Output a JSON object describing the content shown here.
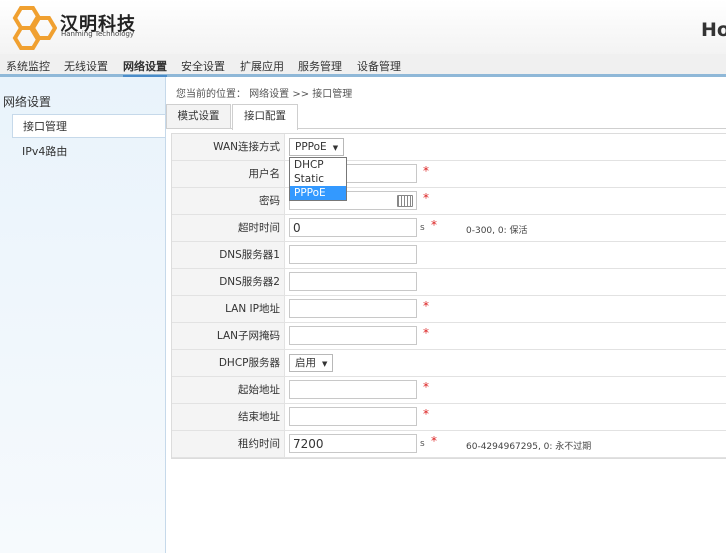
{
  "header": {
    "brand_cn": "汉明科技",
    "brand_en": "Hanming Technology",
    "right_title": "Ho",
    "logo_icon": "hexagon-logo-icon",
    "logo_color": "#f0a030"
  },
  "topnav": {
    "items": [
      "系统监控",
      "无线设置",
      "网络设置",
      "安全设置",
      "扩展应用",
      "服务管理",
      "设备管理"
    ],
    "active": "网络设置"
  },
  "sidebar": {
    "title": "网络设置",
    "items": [
      "接口管理",
      "IPv4路由"
    ],
    "active": "接口管理"
  },
  "breadcrumb": "您当前的位置： 网络设置 >> 接口管理",
  "tabs": [
    "模式设置",
    "接口配置"
  ],
  "active_tab": "接口配置",
  "form": {
    "wan_mode": {
      "label": "WAN连接方式",
      "value": "PPPoE",
      "options": [
        "DHCP",
        "Static",
        "PPPoE"
      ]
    },
    "username": {
      "label": "用户名",
      "value": "",
      "required": "*"
    },
    "password": {
      "label": "密码",
      "value": "",
      "required": "*",
      "icon": "keyboard-icon"
    },
    "timeout": {
      "label": "超时时间",
      "value": "0",
      "unit": "s",
      "required": "*",
      "hint": "0-300, 0: 保活"
    },
    "dns1": {
      "label": "DNS服务器1",
      "value": ""
    },
    "dns2": {
      "label": "DNS服务器2",
      "value": ""
    },
    "lan_ip": {
      "label": "LAN IP地址",
      "value": "",
      "required": "*"
    },
    "lan_mask": {
      "label": "LAN子网掩码",
      "value": "",
      "required": "*"
    },
    "dhcp": {
      "label": "DHCP服务器",
      "value": "启用"
    },
    "start": {
      "label": "起始地址",
      "value": "",
      "required": "*"
    },
    "end": {
      "label": "结束地址",
      "value": "",
      "required": "*"
    },
    "lease": {
      "label": "租约时间",
      "value": "7200",
      "unit": "s",
      "required": "*",
      "hint": "60-4294967295, 0: 永不过期"
    }
  }
}
